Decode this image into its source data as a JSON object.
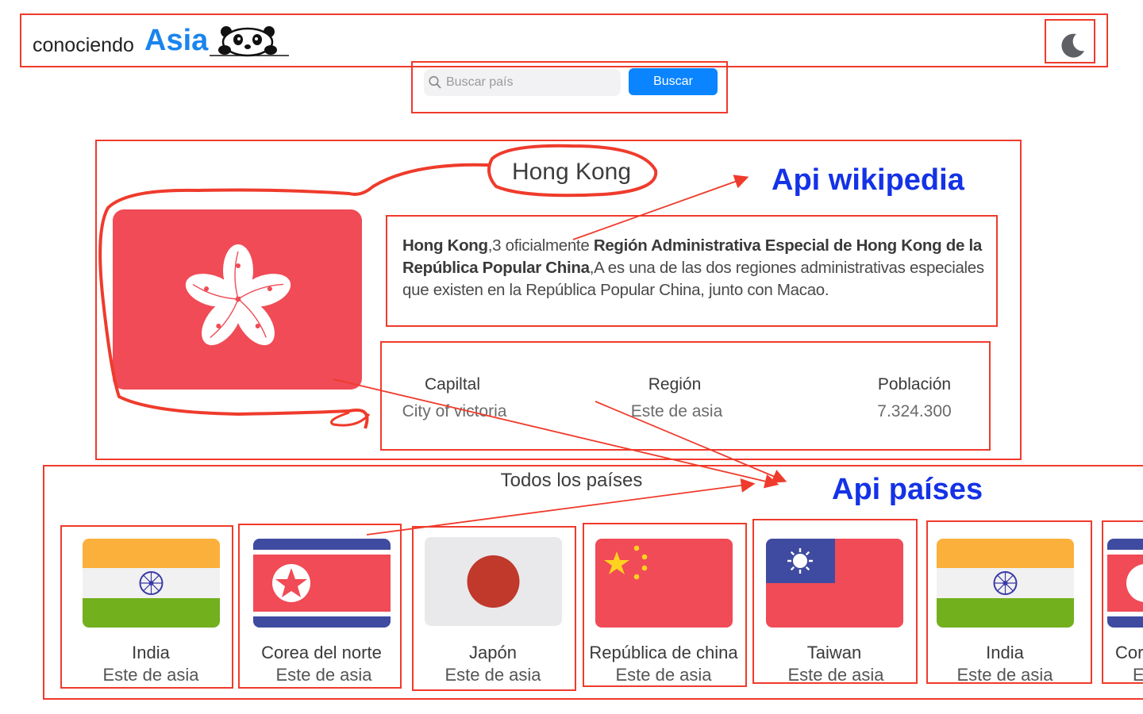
{
  "header": {
    "brand_prefix": "conociendo",
    "brand_main": "Asia",
    "theme_toggle_icon": "moon-icon"
  },
  "search": {
    "placeholder": "Buscar país",
    "value": "",
    "button_label": "Buscar",
    "icon": "search-icon"
  },
  "detail": {
    "title": "Hong Kong",
    "description": {
      "b1": "Hong Kong",
      "t1": ",3 oficialmente ",
      "b2": "Región Administrativa Especial de Hong Kong de la República Popular China",
      "t2": ",A es una de las dos regiones administrativas especiales que existen en la República Popular China, junto con Macao."
    },
    "stats": [
      {
        "label": "Capiltal",
        "value": "City of victoria"
      },
      {
        "label": "Región",
        "value": "Este de asia"
      },
      {
        "label": "Población",
        "value": "7.324.300"
      }
    ]
  },
  "all_countries": {
    "title": "Todos los países",
    "cards": [
      {
        "name": "India",
        "region": "Este de asia",
        "flag": "india-flag"
      },
      {
        "name": "Corea del norte",
        "region": "Este de asia",
        "flag": "north-korea-flag"
      },
      {
        "name": "Japón",
        "region": "Este de asia",
        "flag": "japan-flag"
      },
      {
        "name": "República de china",
        "region": "Este de asia",
        "flag": "china-flag"
      },
      {
        "name": "Taiwan",
        "region": "Este de asia",
        "flag": "taiwan-flag"
      },
      {
        "name": "India",
        "region": "Este de asia",
        "flag": "india-flag"
      },
      {
        "name": "Corea del norte",
        "region": "Este de asia",
        "flag": "north-korea-flag"
      }
    ]
  },
  "annotations": {
    "wikipedia": "Api wikipedia",
    "paises": "Api países"
  },
  "colors": {
    "accent": "#0a84ff",
    "brand": "#1a84ee",
    "annotation_box": "#ef3b2c",
    "annotation_text": "#1432e6",
    "hk_flag": "#f04b56"
  }
}
